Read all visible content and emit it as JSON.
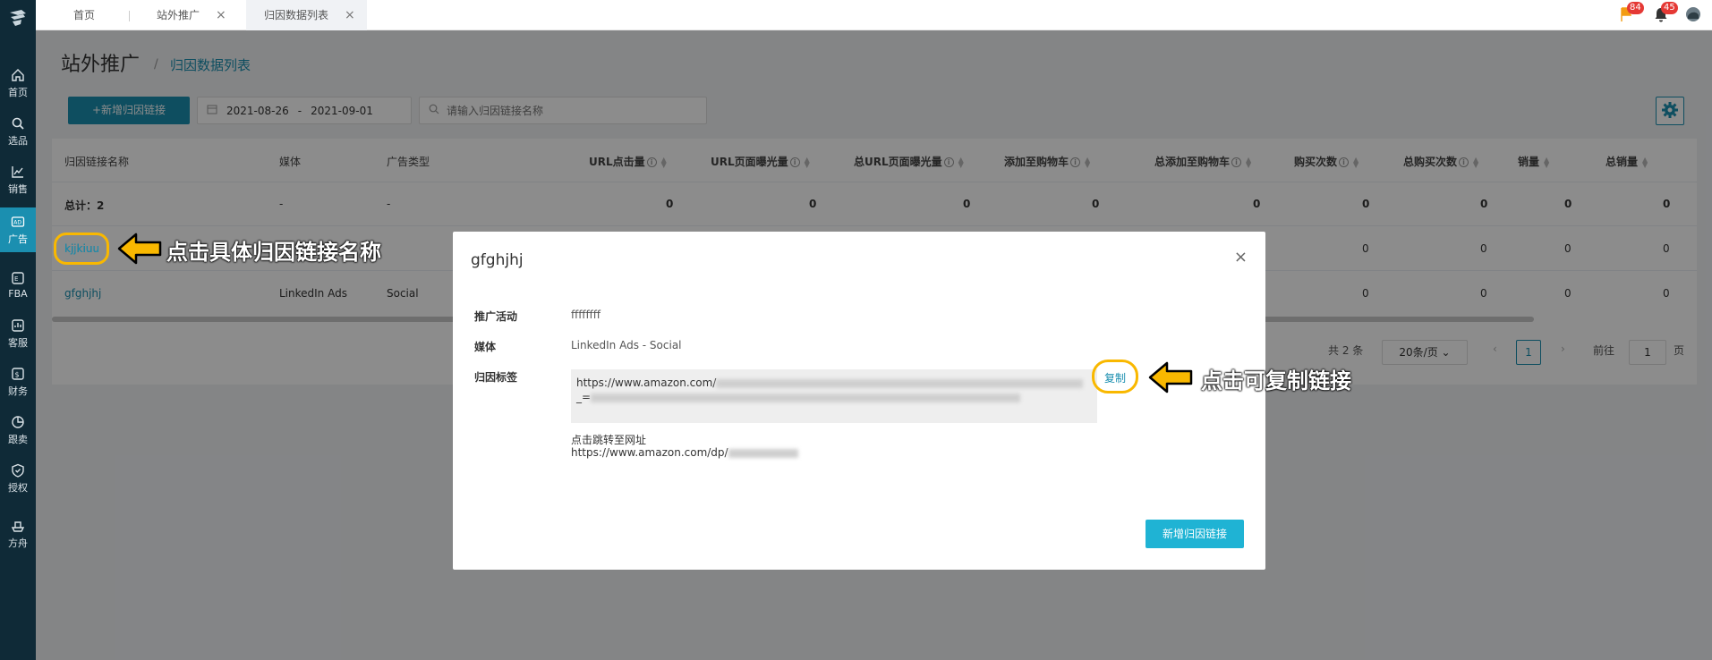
{
  "sidebar": {
    "items": [
      {
        "label": "首页",
        "icon": "home-icon"
      },
      {
        "label": "选品",
        "icon": "search-icon"
      },
      {
        "label": "销售",
        "icon": "chart-line-icon"
      },
      {
        "label": "广告",
        "icon": "ad-icon"
      },
      {
        "label": "FBA",
        "icon": "fba-icon"
      },
      {
        "label": "客服",
        "icon": "customer-service-icon"
      },
      {
        "label": "财务",
        "icon": "finance-icon"
      },
      {
        "label": "跟卖",
        "icon": "pie-chart-icon"
      },
      {
        "label": "授权",
        "icon": "shield-icon"
      },
      {
        "label": "方舟",
        "icon": "ark-icon"
      }
    ]
  },
  "tabs": [
    {
      "label": "首页"
    },
    {
      "label": "站外推广"
    },
    {
      "label": "归因数据列表"
    }
  ],
  "header": {
    "flag_badge": "84",
    "bell_badge": "45"
  },
  "page": {
    "title": "站外推广",
    "breadcrumb_sep": "/",
    "breadcrumb_current": "归因数据列表"
  },
  "toolbar": {
    "add_button": "+新增归因链接",
    "date_start": "2021-08-26",
    "date_sep": "-",
    "date_end": "2021-09-01",
    "search_placeholder": "请输入归因链接名称"
  },
  "table": {
    "headers": [
      "归因链接名称",
      "媒体",
      "广告类型",
      "URL点击量",
      "URL页面曝光量",
      "总URL页面曝光量",
      "添加至购物车",
      "总添加至购物车",
      "购买次数",
      "总购买次数",
      "销量",
      "总销量"
    ],
    "total_row": [
      "总计：2",
      "-",
      "-",
      "0",
      "0",
      "0",
      "0",
      "0",
      "0",
      "0",
      "0",
      "0"
    ],
    "rows": [
      {
        "name": "kjjkiuu",
        "media": "",
        "type": "",
        "c1": "0",
        "c2": "0",
        "c3": "0",
        "c4": "0"
      },
      {
        "name": "gfghjhj",
        "media": "LinkedIn Ads",
        "type": "Social",
        "c1": "0",
        "c2": "0",
        "c3": "0",
        "c4": "0"
      }
    ]
  },
  "pager": {
    "total": "共 2 条",
    "page_size": "20条/页",
    "current": "1",
    "goto_label": "前往",
    "goto_value": "1",
    "goto_unit": "页"
  },
  "modal": {
    "title": "gfghjhj",
    "close": "×",
    "campaign_label": "推广活动",
    "campaign_value": "ffffffff",
    "media_label": "媒体",
    "media_value": "LinkedIn Ads - Social",
    "tag_label": "归因标签",
    "tag_url": "https://www.amazon.com/",
    "tag_line2_prefix": "_=",
    "copy": "复制",
    "jump_label": "点击跳转至网址",
    "jump_url": "https://www.amazon.com/dp/",
    "submit": "新增归因链接"
  },
  "annotations": {
    "left": "点击具体归因链接名称",
    "right": "点击可复制链接"
  },
  "colors": {
    "accent": "#1b8fb0",
    "sidebar": "#0f2a37",
    "highlight": "#f9b800",
    "modal_button": "#1fb3d4"
  }
}
